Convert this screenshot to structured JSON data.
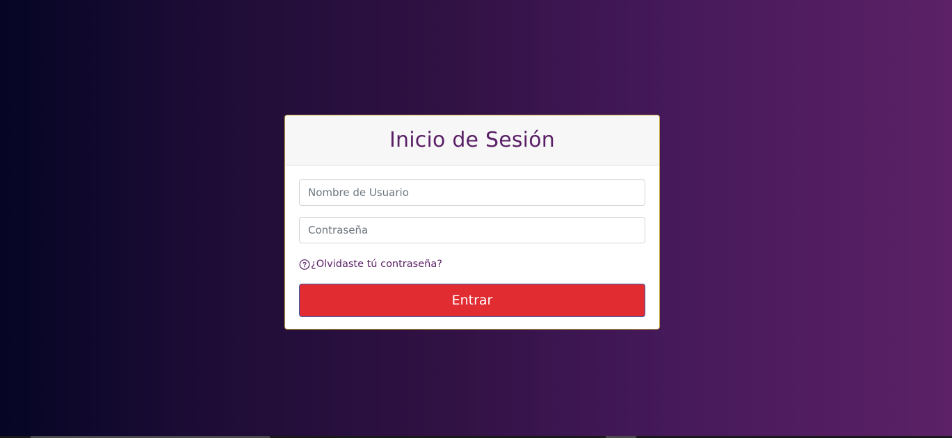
{
  "login": {
    "title": "Inicio de Sesión",
    "username_placeholder": "Nombre de Usuario",
    "password_placeholder": "Contraseña",
    "username_value": "",
    "password_value": "",
    "forgot_label": "¿Olvidaste tú contraseña?",
    "forgot_icon": "question-circle-icon",
    "submit_label": "Entrar"
  },
  "colors": {
    "accent": "#5a1f66",
    "button": "#e12c32",
    "background_start": "#050525",
    "background_end": "#5c2166"
  }
}
